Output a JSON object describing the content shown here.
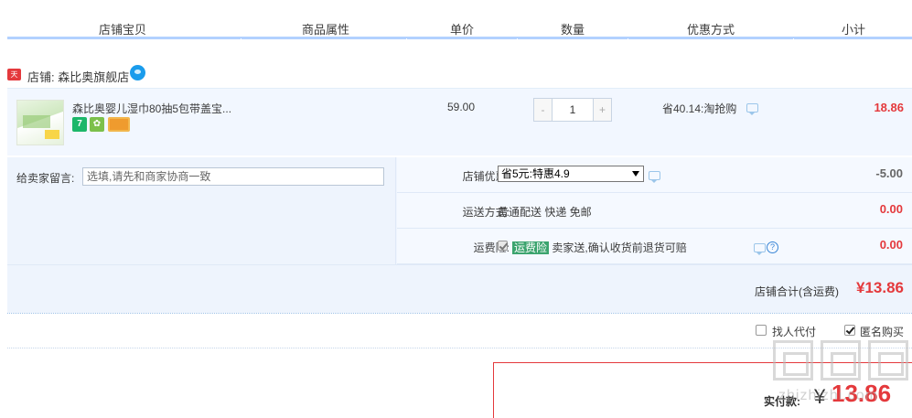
{
  "header": {
    "columns": [
      "店铺宝贝",
      "商品属性",
      "单价",
      "数量",
      "优惠方式",
      "小计"
    ]
  },
  "shop": {
    "badge": "天猫",
    "label": "店铺: 森比奥旗舰店"
  },
  "item": {
    "title": "森比奥婴儿湿巾80抽5包带盖宝...",
    "service_icons": [
      "seven-day-return-icon",
      "quality-guarantee-icon",
      "credit-card-icon"
    ],
    "price": "59.00",
    "quantity": "1",
    "minus": "-",
    "plus": "+",
    "promo": "省40.14:淘抢购",
    "subtotal": "18.86"
  },
  "message": {
    "label": "给卖家留言:",
    "placeholder": "选填,请先和商家协商一致"
  },
  "shop_discount": {
    "label": "店铺优惠:",
    "selected": "省5元:特惠4.9",
    "amount": "-5.00"
  },
  "shipping": {
    "label": "运送方式:",
    "value": "普通配送 快递 免邮",
    "amount": "0.00"
  },
  "shipping_insurance": {
    "label": "运费险:",
    "tag": "运费险",
    "text": "卖家送,确认收货前退货可赔",
    "amount": "0.00"
  },
  "shop_total": {
    "label": "店铺合计(含运费)",
    "amount": "¥13.86"
  },
  "options": {
    "proxy_pay": "找人代付",
    "anonymous": "匿名购买",
    "anonymous_checked": true
  },
  "payment": {
    "label": "实付款:",
    "yen": "¥",
    "amount": "13.86"
  },
  "watermark": {
    "text": "zhizhizhi.com"
  },
  "colors": {
    "accent_red": "#e4393c",
    "header_line": "#b2d1ff",
    "row_bg": "#f2f7ff"
  }
}
